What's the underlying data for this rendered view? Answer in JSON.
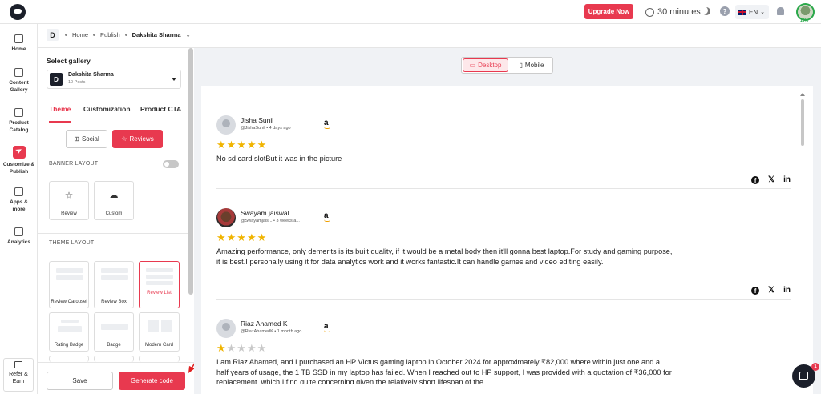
{
  "topbar": {
    "upgrade_label": "Upgrade Now",
    "timer_label": "30 minutes",
    "help_label": "?",
    "lang_label": "EN",
    "avatar_progress": "10%"
  },
  "leftnav": {
    "items": [
      {
        "label": "Home",
        "icon": "home-icon"
      },
      {
        "label": "Content Gallery",
        "icon": "image-icon"
      },
      {
        "label": "Product Catalog",
        "icon": "bag-icon"
      },
      {
        "label": "Customize & Publish",
        "icon": "send-icon"
      },
      {
        "label": "Apps & more",
        "icon": "apps-grid-icon"
      },
      {
        "label": "Analytics",
        "icon": "chart-icon"
      }
    ],
    "refer_label": "Refer & Earn"
  },
  "breadcrumb": {
    "badge": "D",
    "items": [
      "Home",
      "Publish",
      "Dakshita Sharma"
    ]
  },
  "panel": {
    "select_gallery_title": "Select gallery",
    "gallery": {
      "badge": "D",
      "name": "Dakshita Sharma",
      "posts": "10 Posts"
    },
    "tabs": [
      "Theme",
      "Customization",
      "Product CTA"
    ],
    "active_tab": "Theme",
    "source_buttons": [
      "Social",
      "Reviews"
    ],
    "active_source": "Reviews",
    "banner_layout_title": "BANNER LAYOUT",
    "banner_toggle": false,
    "banner_cards": [
      "Review",
      "Custom"
    ],
    "theme_layout_title": "THEME LAYOUT",
    "theme_cards": [
      "Review Carousel",
      "Review Box",
      "Review List",
      "Rating Badge",
      "Badge",
      "Modern Card"
    ],
    "active_theme_card": "Review List",
    "save_label": "Save",
    "generate_label": "Generate code"
  },
  "preview": {
    "view_options": [
      "Desktop",
      "Mobile"
    ],
    "active_view": "Desktop",
    "reviews": [
      {
        "name": "Jisha Sunil",
        "handle": "@JishaSunil",
        "time": "4 days ago",
        "source": "a",
        "rating": 5,
        "text": "No sd card slotBut it was in the picture"
      },
      {
        "name": "Swayam jaiswal",
        "handle": "@Swayamjais...",
        "time": "3 weeks a...",
        "source": "a",
        "rating": 5,
        "text": "Amazing performance, only demerits is its built quality, if it would be a metal body then it'll gonna best laptop.For study and gaming purpose, it is best.I personally using it for data analytics work and it works fantastic.It can handle games and video editing easily."
      },
      {
        "name": "Riaz Ahamed K",
        "handle": "@RiazAhamedK",
        "time": "1 month ago",
        "source": "a",
        "rating": 1,
        "text": "I am Riaz Ahamed, and I purchased an HP Victus gaming laptop in October 2024 for approximately ₹82,000 where within just one and a half years of usage, the 1 TB SSD in my laptop has failed. When I reached out to HP support, I was provided with a quotation of ₹36,000 for replacement, which I find quite concerning given the relatively short lifespan of the"
      }
    ],
    "share_icons": [
      "facebook-icon",
      "x-icon",
      "linkedin-icon"
    ],
    "chat_badge": "1"
  },
  "colors": {
    "accent": "#e8394f",
    "star": "#f0b400",
    "dark": "#1b1f2a"
  }
}
